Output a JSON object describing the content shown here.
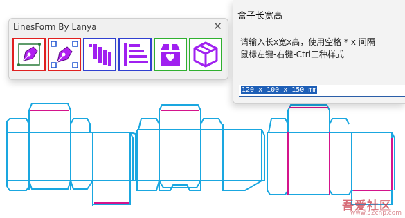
{
  "toolbar": {
    "title": "LinesForm By Lanya",
    "close_glyph": "✕",
    "buttons": [
      {
        "icon": "pen-nib-select-icon",
        "border_color": "#e02020"
      },
      {
        "icon": "pen-nib-nodes-icon",
        "border_color": "#e02020"
      },
      {
        "icon": "vertical-lines-icon",
        "border_color": "#3040d0"
      },
      {
        "icon": "horizontal-lines-icon",
        "border_color": "#3040d0"
      },
      {
        "icon": "gift-box-heart-icon",
        "border_color": "#30b030"
      },
      {
        "icon": "3d-box-icon",
        "border_color": "#30b030"
      }
    ],
    "icon_color": "#a020f0"
  },
  "dialog": {
    "title": "盒子长宽高",
    "prompt_line1": "请输入长x宽x高，使用空格 * x 间隔",
    "prompt_line2": "鼠标左键-右键-Ctrl三种样式",
    "input_value": "120 x 100 x 150 mm"
  },
  "watermark": {
    "text": "吾爱社区",
    "url": "www.52cnp.com"
  },
  "colors": {
    "cut_line": "#1aa7e0",
    "crease_line": "#d4148c"
  }
}
